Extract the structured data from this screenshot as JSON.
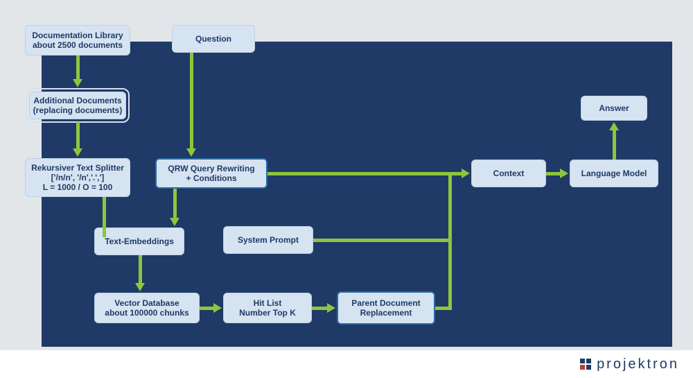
{
  "nodes": {
    "doc_library_l1": "Documentation Library",
    "doc_library_l2": "about 2500 documents",
    "additional_l1": "Additional Documents",
    "additional_l2": "(replacing documents)",
    "splitter_l1": "Rekursiver Text Splitter",
    "splitter_l2": "['/n/n', '/n','.',']",
    "splitter_l3": "L = 1000 / O = 100",
    "embeddings": "Text-Embeddings",
    "vector_l1": "Vector Database",
    "vector_l2": "about 100000 chunks",
    "question": "Question",
    "qrw_l1": "QRW Query Rewriting",
    "qrw_l2": "+ Conditions",
    "system_prompt": "System Prompt",
    "hitlist_l1": "Hit List",
    "hitlist_l2": "Number Top K",
    "parent_l1": "Parent Document",
    "parent_l2": "Replacement",
    "context": "Context",
    "lm": "Language Model",
    "answer": "Answer"
  },
  "brand": {
    "name": "projektron",
    "logo_colors": {
      "tl": "#1f3a66",
      "tr": "#1f3a66",
      "bl": "#c0392b",
      "br": "#1f3a66"
    }
  },
  "palette": {
    "navy": "#1f3a66",
    "node_bg": "#d6e3f1",
    "arrow": "#8cc63f",
    "page_bg": "#e3e6e9"
  }
}
